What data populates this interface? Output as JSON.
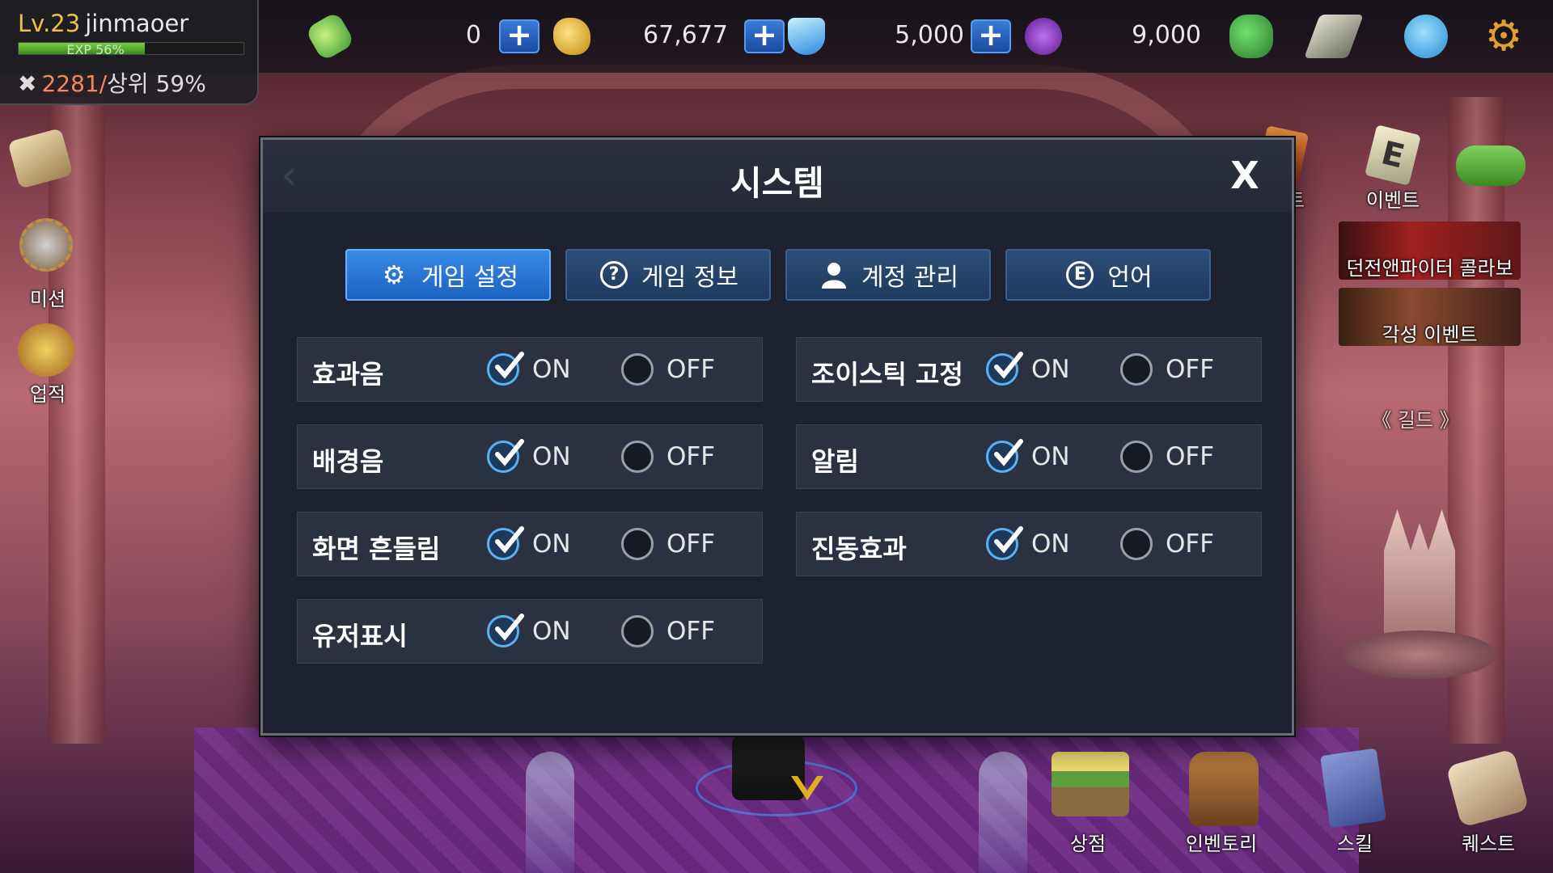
{
  "player": {
    "level": "Lv.23",
    "name": "jinmaoer",
    "exp_label": "EXP 56%",
    "exp_fraction": 0.56,
    "rank_value": "2281/",
    "rank_text": "상위 59%"
  },
  "currency": {
    "stamina": "0",
    "gold": "67,677",
    "gem": "5,000",
    "crystal": "9,000"
  },
  "side_menu": {
    "mission": "미션",
    "achievement": "업적",
    "event1": "이벤트",
    "event2": "이벤트",
    "banner1": "던전앤파이터 콜라보",
    "banner2": "각성 이벤트",
    "guild": "《 길드 》"
  },
  "bottom_menu": {
    "shop": "상점",
    "inventory": "인벤토리",
    "skill": "스킬",
    "quest": "퀘스트"
  },
  "dialog": {
    "title": "시스템",
    "close": "X",
    "tabs": [
      {
        "label": "게임 설정",
        "icon": "gear-icon",
        "active": true
      },
      {
        "label": "게임 정보",
        "icon": "question-icon",
        "active": false
      },
      {
        "label": "계정 관리",
        "icon": "user-icon",
        "active": false
      },
      {
        "label": "언어",
        "icon": "language-icon",
        "active": false
      }
    ],
    "on_label": "ON",
    "off_label": "OFF",
    "settings_left": [
      {
        "label": "효과음",
        "value": "ON"
      },
      {
        "label": "배경음",
        "value": "ON"
      },
      {
        "label": "화면 흔들림",
        "value": "ON"
      },
      {
        "label": "유저표시",
        "value": "ON"
      }
    ],
    "settings_right": [
      {
        "label": "조이스틱 고정",
        "value": "ON"
      },
      {
        "label": "알림",
        "value": "ON"
      },
      {
        "label": "진동효과",
        "value": "ON"
      }
    ]
  },
  "colors": {
    "accent": "#3a8ae8",
    "check": "#5ab0f0",
    "gold": "#f0c040"
  }
}
